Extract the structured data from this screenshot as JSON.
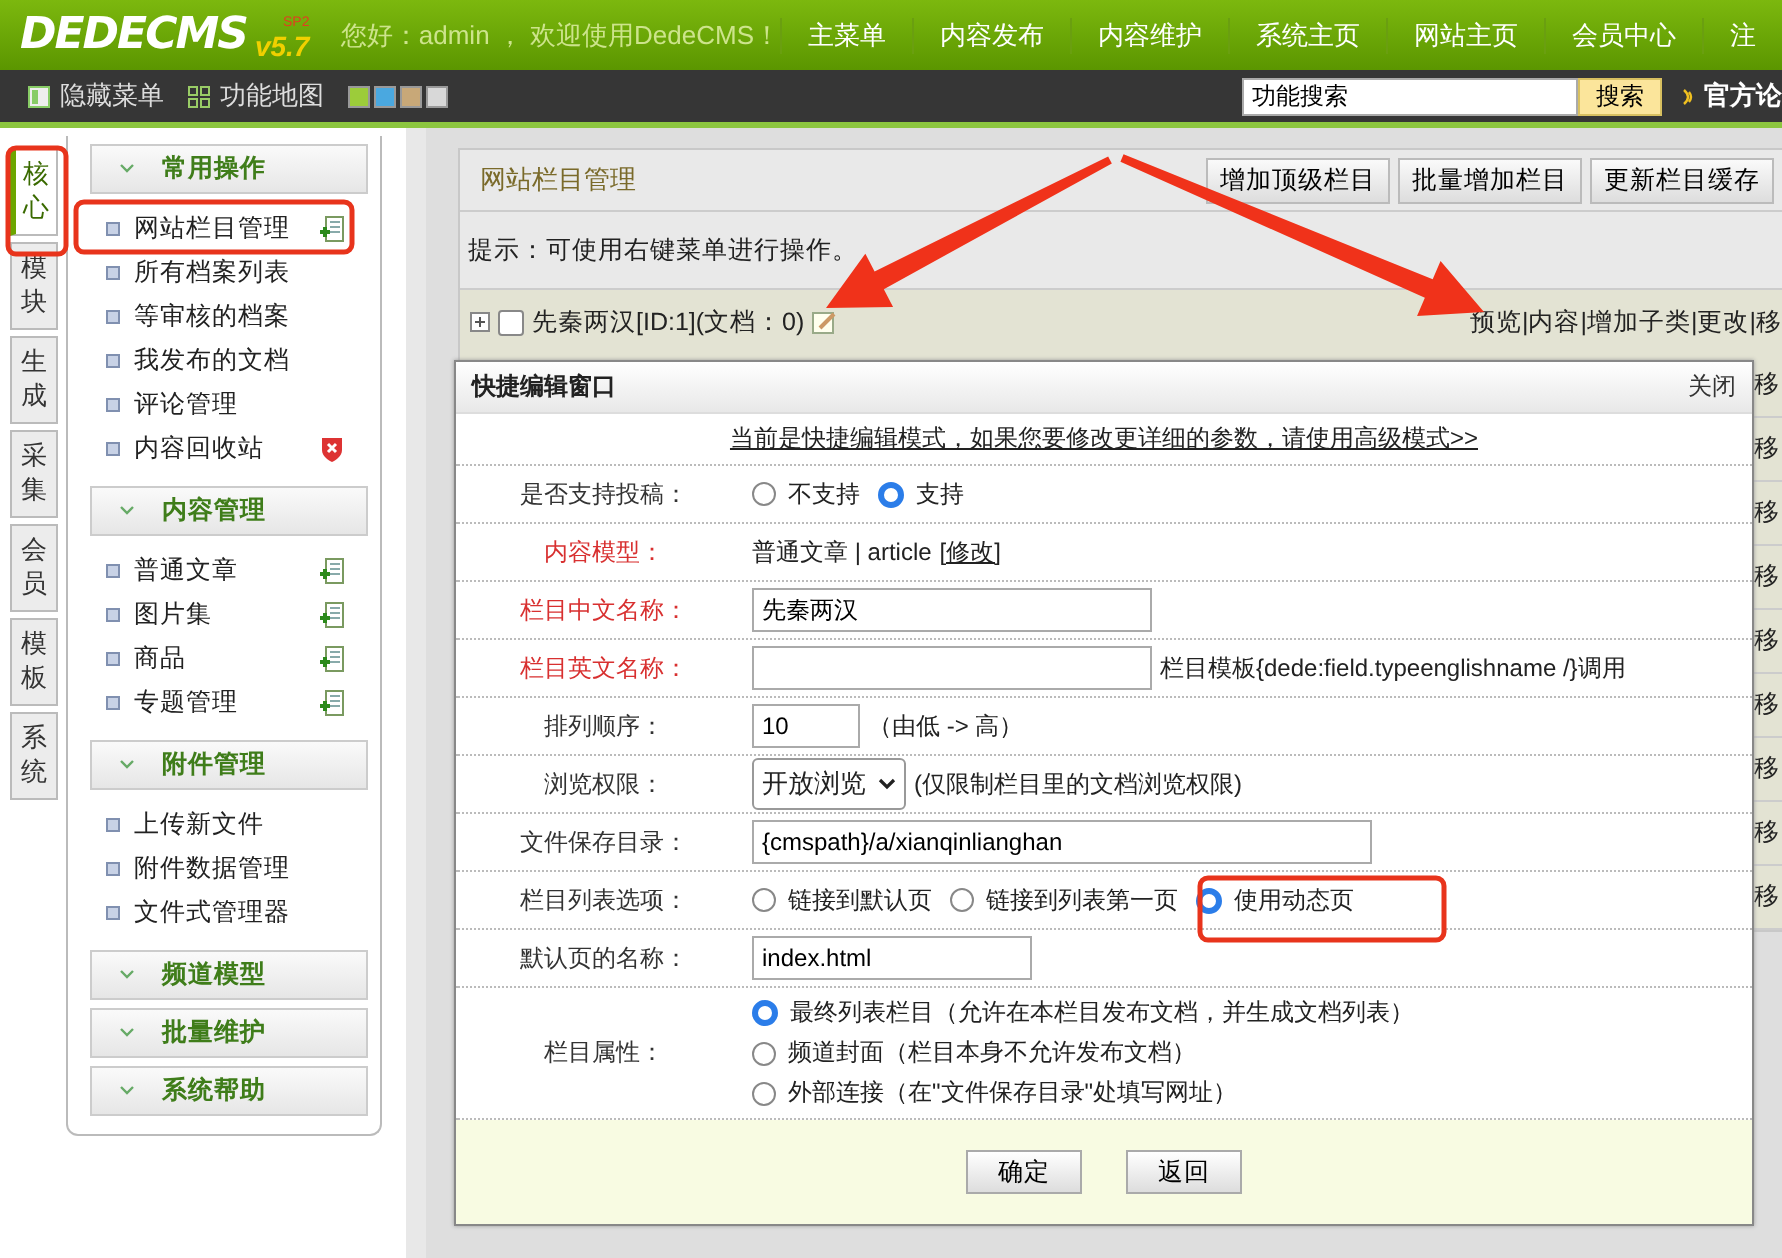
{
  "header": {
    "logo": "DEDECMS",
    "version": "v5.7",
    "version_tag": "SP2",
    "welcome": "您好：admin ， 欢迎使用DedeCMS！",
    "nav": [
      "主菜单",
      "内容发布",
      "内容维护",
      "系统主页",
      "网站主页",
      "会员中心",
      "注"
    ]
  },
  "toolbar": {
    "items": [
      {
        "label": "隐藏菜单",
        "kind": "hide"
      },
      {
        "label": "功能地图",
        "kind": "map"
      }
    ],
    "swatches": [
      {
        "color": "#9ccc3a"
      },
      {
        "color": "#4aa8e0"
      },
      {
        "color": "#c8a878"
      },
      {
        "color": "#d8d8d8"
      }
    ],
    "search": {
      "value": "功能搜索"
    },
    "search_button": "搜索",
    "forum_link": "官方论"
  },
  "side_tabs": [
    {
      "label": "核心",
      "selected": true
    },
    {
      "label": "模块",
      "selected": false
    },
    {
      "label": "生成",
      "selected": false
    },
    {
      "label": "采集",
      "selected": false
    },
    {
      "label": "会员",
      "selected": false
    },
    {
      "label": "模板",
      "selected": false
    },
    {
      "label": "系统",
      "selected": false
    }
  ],
  "menu": [
    {
      "title": "常用操作",
      "items": [
        {
          "label": "网站栏目管理",
          "kind": "add"
        },
        {
          "label": "所有档案列表",
          "kind": "plain"
        },
        {
          "label": "等审核的档案",
          "kind": "plain"
        },
        {
          "label": "我发布的文档",
          "kind": "plain"
        },
        {
          "label": "评论管理",
          "kind": "plain"
        },
        {
          "label": "内容回收站",
          "kind": "delete"
        }
      ]
    },
    {
      "title": "内容管理",
      "items": [
        {
          "label": "普通文章",
          "kind": "add"
        },
        {
          "label": "图片集",
          "kind": "add"
        },
        {
          "label": "商品",
          "kind": "add"
        },
        {
          "label": "专题管理",
          "kind": "add"
        }
      ]
    },
    {
      "title": "附件管理",
      "items": [
        {
          "label": "上传新文件",
          "kind": "plain"
        },
        {
          "label": "附件数据管理",
          "kind": "plain"
        },
        {
          "label": "文件式管理器",
          "kind": "plain"
        }
      ]
    },
    {
      "title": "频道模型"
    },
    {
      "title": "批量维护"
    },
    {
      "title": "系统帮助"
    }
  ],
  "main": {
    "title": "网站栏目管理",
    "buttons": [
      "增加顶级栏目",
      "批量增加栏目",
      "更新栏目缓存"
    ],
    "hint": "提示：可使用右键菜单进行操作。",
    "category": {
      "name": "先秦两汉[ID:1](文档：0)",
      "checked": false,
      "actions": "预览|内容|增加子类|更改|移"
    },
    "right_cells": [
      "移",
      "移",
      "移",
      "移",
      "移",
      "移",
      "移",
      "移",
      "移"
    ]
  },
  "dialog": {
    "title": "快捷编辑窗口",
    "close": "关闭",
    "notice": "当前是快捷编辑模式，如果您要修改更详细的参数，请使用高级模式>>",
    "fields": [
      {
        "kind": "radio",
        "label": "是否支持投稿：",
        "required": false,
        "options": [
          {
            "label": "不支持",
            "selected": false
          },
          {
            "label": "支持",
            "selected": true
          }
        ]
      },
      {
        "kind": "text",
        "label": "内容模型：",
        "required": true,
        "text": "普通文章 | article",
        "link": "[修改]"
      },
      {
        "kind": "input",
        "label": "栏目中文名称：",
        "required": true,
        "value": "先秦两汉"
      },
      {
        "kind": "input",
        "label": "栏目英文名称：",
        "required": true,
        "note": "栏目模板{dede:field.typeenglishname /}调用"
      },
      {
        "kind": "number",
        "label": "排列顺序：",
        "required": false,
        "value": "10",
        "note": "（由低 -> 高）"
      },
      {
        "kind": "select",
        "label": "浏览权限：",
        "required": false,
        "value": "开放浏览",
        "note": "(仅限制栏目里的文档浏览权限)"
      },
      {
        "kind": "path",
        "label": "文件保存目录：",
        "required": false,
        "value": "{cmspath}/a/xianqinlianghan"
      },
      {
        "kind": "radio",
        "label": "栏目列表选项：",
        "required": false,
        "options": [
          {
            "label": "链接到默认页",
            "selected": false
          },
          {
            "label": "链接到列表第一页",
            "selected": false
          },
          {
            "label": "使用动态页",
            "selected": true
          }
        ]
      },
      {
        "kind": "filename",
        "label": "默认页的名称：",
        "required": false,
        "value": "index.html"
      },
      {
        "kind": "radio-stack",
        "label": "栏目属性：",
        "required": false,
        "options": [
          {
            "label": "最终列表栏目（允许在本栏目发布文档，并生成文档列表）",
            "selected": true
          },
          {
            "label": "频道封面（栏目本身不允许发布文档）",
            "selected": false
          },
          {
            "label": "外部连接（在\"文件保存目录\"处填写网址）",
            "selected": false
          }
        ]
      }
    ],
    "buttons": [
      "确定",
      "返回"
    ]
  }
}
